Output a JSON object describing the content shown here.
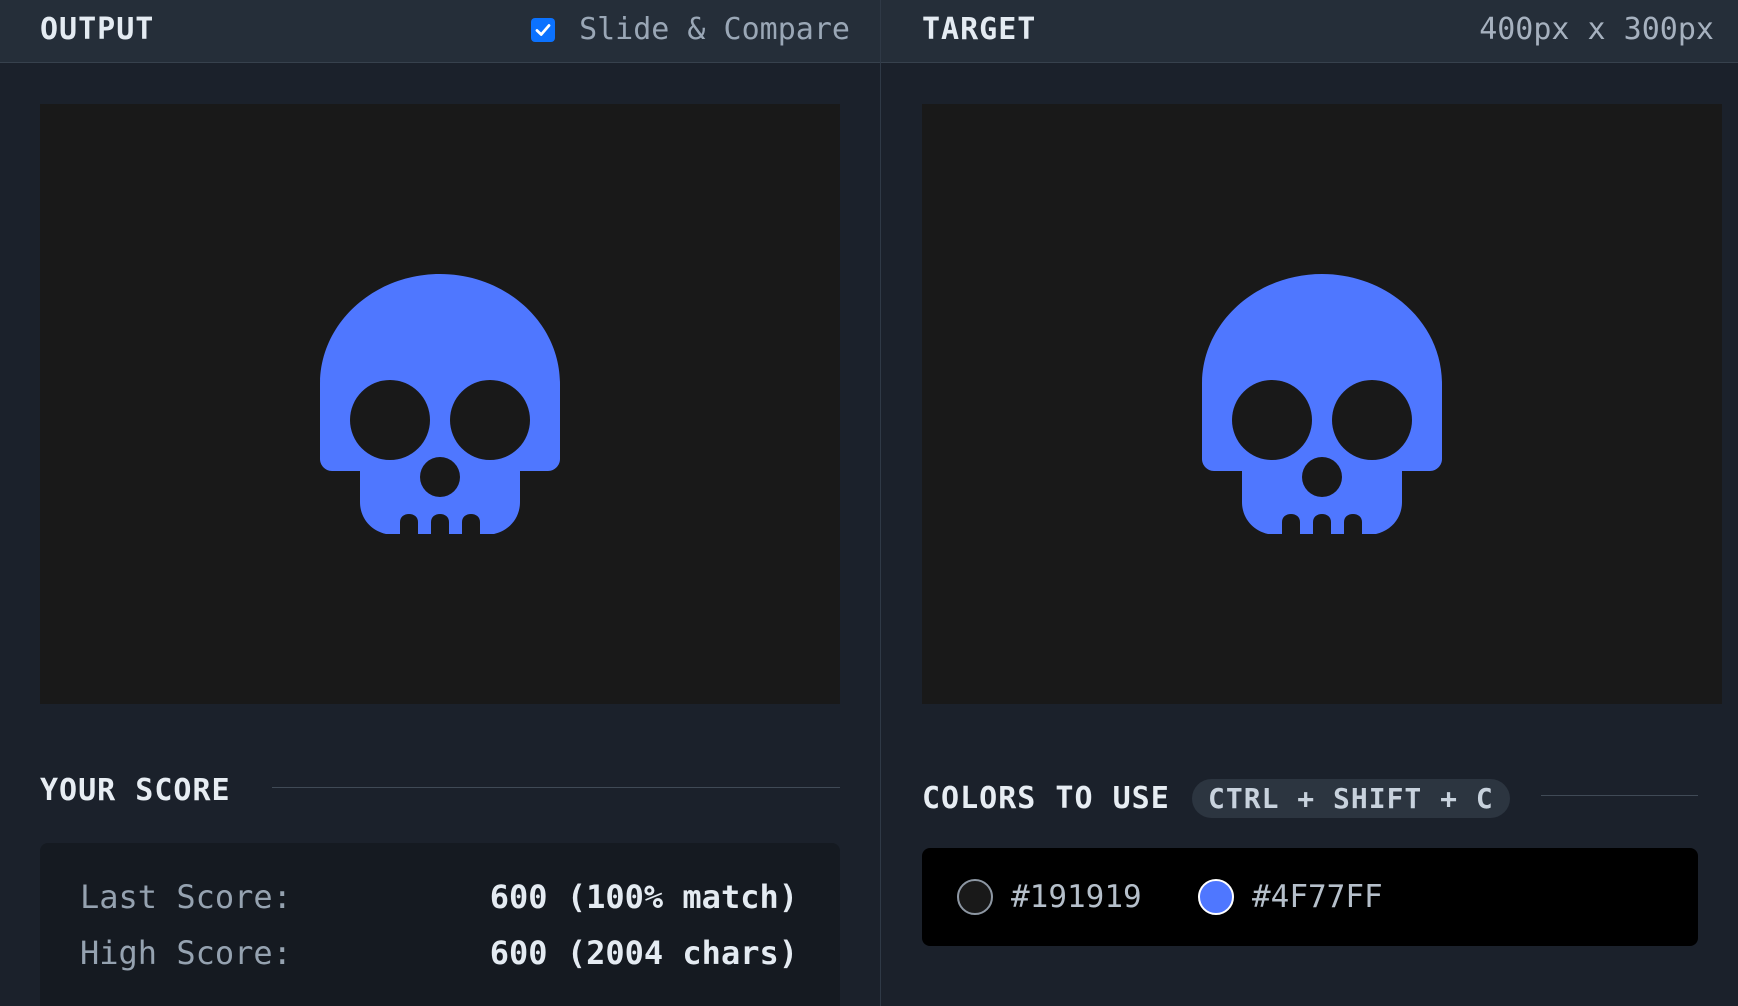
{
  "output": {
    "title": "OUTPUT",
    "compare_label": "Slide & Compare",
    "compare_checked": true,
    "score_title": "YOUR SCORE",
    "scores": [
      {
        "label": "Last Score:",
        "value": "600 (100% match)"
      },
      {
        "label": "High Score:",
        "value": "600 (2004 chars)"
      }
    ]
  },
  "target": {
    "title": "TARGET",
    "dimensions": "400px x 300px",
    "colors_title": "COLORS TO USE",
    "shortcut": "CTRL + SHIFT + C",
    "colors": [
      {
        "hex": "#191919",
        "label": "#191919"
      },
      {
        "hex": "#4F77FF",
        "label": "#4F77FF"
      }
    ]
  },
  "canvas": {
    "background": "#191919",
    "shape_color": "#4F77FF",
    "shape_icon": "skull-icon"
  },
  "colors": {
    "accent": "#0b72ff",
    "header_bg": "#252e39",
    "body_bg": "#1b212b"
  }
}
